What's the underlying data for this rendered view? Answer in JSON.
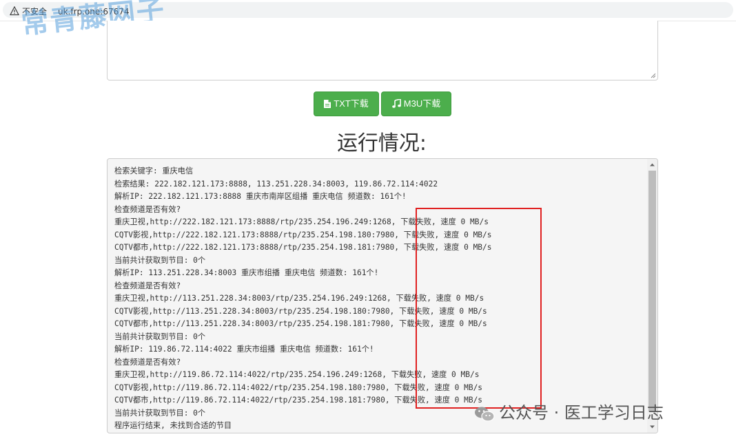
{
  "browser": {
    "insecure_label": "不安全",
    "url": "uk.frp.one:67674"
  },
  "watermark_top": "常青藤网子",
  "buttons": {
    "txt_download": "TXT下载",
    "m3u_download": "M3U下载"
  },
  "section_title": "运行情况:",
  "log_lines": [
    "检索关键字: 重庆电信",
    "检索结果: 222.182.121.173:8888, 113.251.228.34:8003, 119.86.72.114:4022",
    "解析IP: 222.182.121.173:8888 重庆市南岸区组播 重庆电信 频道数: 161个!",
    "检查频道是否有效?",
    "重庆卫视,http://222.182.121.173:8888/rtp/235.254.196.249:1268, 下载失败, 速度 0 MB/s",
    "CQTV影视,http://222.182.121.173:8888/rtp/235.254.198.180:7980, 下载失败, 速度 0 MB/s",
    "CQTV都市,http://222.182.121.173:8888/rtp/235.254.198.181:7980, 下载失败, 速度 0 MB/s",
    "当前共计获取到节目: 0个",
    "解析IP: 113.251.228.34:8003 重庆市组播 重庆电信 频道数: 161个!",
    "检查频道是否有效?",
    "重庆卫视,http://113.251.228.34:8003/rtp/235.254.196.249:1268, 下载失败, 速度 0 MB/s",
    "CQTV影视,http://113.251.228.34:8003/rtp/235.254.198.180:7980, 下载失败, 速度 0 MB/s",
    "CQTV都市,http://113.251.228.34:8003/rtp/235.254.198.181:7980, 下载失败, 速度 0 MB/s",
    "当前共计获取到节目: 0个",
    "解析IP: 119.86.72.114:4022 重庆市组播 重庆电信 频道数: 161个!",
    "检查频道是否有效?",
    "重庆卫视,http://119.86.72.114:4022/rtp/235.254.196.249:1268, 下载失败, 速度 0 MB/s",
    "CQTV影视,http://119.86.72.114:4022/rtp/235.254.198.180:7980, 下载失败, 速度 0 MB/s",
    "CQTV都市,http://119.86.72.114:4022/rtp/235.254.198.181:7980, 下载失败, 速度 0 MB/s",
    "当前共计获取到节目: 0个",
    "程序运行结束, 未找到合适的节目"
  ],
  "wechat_watermark": "公众号 · 医工学习日志",
  "colors": {
    "button_green": "#4cae4c",
    "highlight_red": "#e02020"
  }
}
